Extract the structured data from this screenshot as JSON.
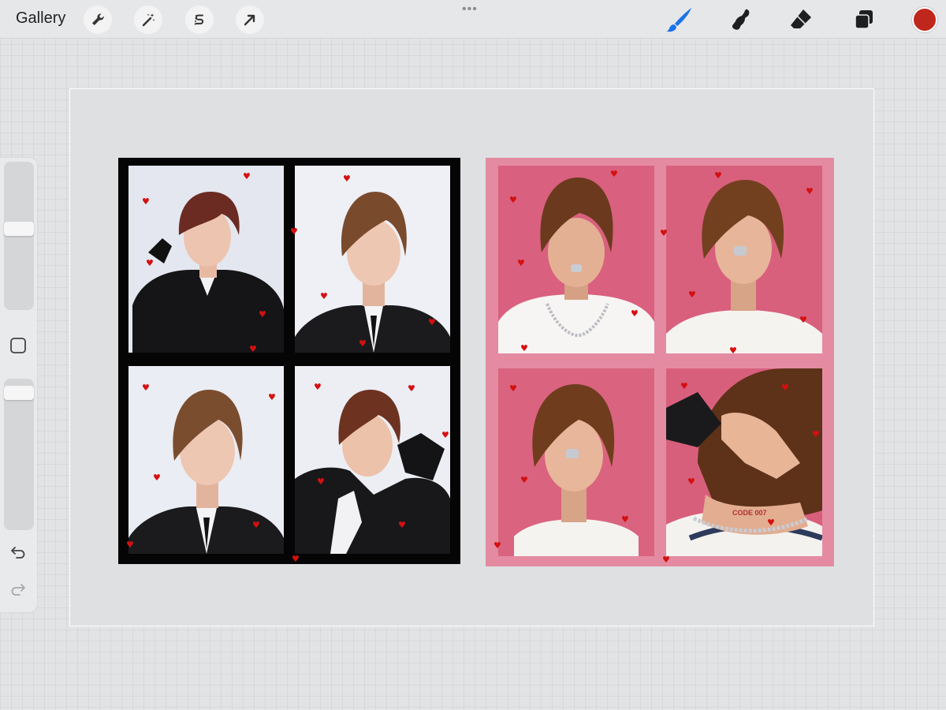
{
  "app": {
    "gallery_label": "Gallery",
    "grip": "•••",
    "active_color": "#c0271c",
    "accent_color": "#1a73e8"
  },
  "toolbar_left": [
    {
      "name": "actions-icon",
      "icon": "wrench"
    },
    {
      "name": "adjustments-icon",
      "icon": "magic-wand"
    },
    {
      "name": "selection-icon",
      "icon": "s-curve"
    },
    {
      "name": "transform-icon",
      "icon": "arrow"
    }
  ],
  "toolbar_right": [
    {
      "name": "brush-icon",
      "icon": "brush",
      "active": true
    },
    {
      "name": "smudge-icon",
      "icon": "smudge"
    },
    {
      "name": "eraser-icon",
      "icon": "eraser"
    },
    {
      "name": "layers-icon",
      "icon": "layers"
    }
  ],
  "sidebar": {
    "brush_size_level": 0.55,
    "opacity_level": 0.05,
    "modify_button_icon": "square",
    "undo_icon": "undo",
    "redo_icon": "redo"
  },
  "collages": {
    "left": {
      "frame_color": "#050505",
      "background_color": "#e9ecf3",
      "heart_color": "#d41010"
    },
    "right": {
      "frame_color": "#e48ba2",
      "background_color": "#d9607e",
      "heart_color": "#d41010",
      "photo_text": "CODE 007"
    }
  },
  "heart_glyph": "♥"
}
